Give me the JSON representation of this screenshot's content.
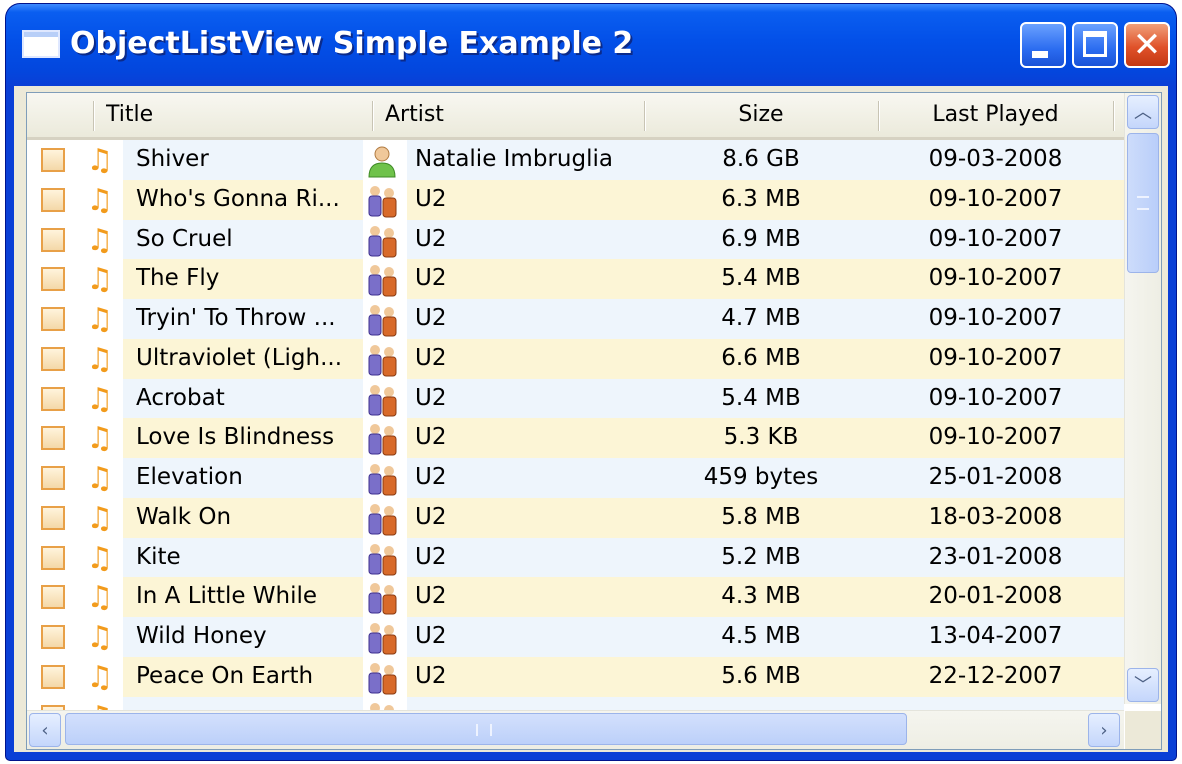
{
  "window": {
    "title": "ObjectListView Simple Example 2",
    "icons": [
      "window-icon",
      "minimize-icon",
      "maximize-icon",
      "close-icon"
    ],
    "accent": "#0a3fd6"
  },
  "listview": {
    "columns": [
      "Title",
      "Artist",
      "Size",
      "Last Played"
    ],
    "row_colors": {
      "even": "#eef5fc",
      "odd": "#fcf5d6"
    },
    "rows": [
      {
        "title": "Shiver",
        "artist": "Natalie Imbruglia",
        "artist_icon": "user-icon",
        "size": "8.6 GB",
        "last_played": "09-03-2008"
      },
      {
        "title": "Who's Gonna Ri...",
        "artist": "U2",
        "artist_icon": "group-icon",
        "size": "6.3 MB",
        "last_played": "09-10-2007"
      },
      {
        "title": "So Cruel",
        "artist": "U2",
        "artist_icon": "group-icon",
        "size": "6.9 MB",
        "last_played": "09-10-2007"
      },
      {
        "title": "The Fly",
        "artist": "U2",
        "artist_icon": "group-icon",
        "size": "5.4 MB",
        "last_played": "09-10-2007"
      },
      {
        "title": "Tryin' To Throw ...",
        "artist": "U2",
        "artist_icon": "group-icon",
        "size": "4.7 MB",
        "last_played": "09-10-2007"
      },
      {
        "title": "Ultraviolet (Ligh...",
        "artist": "U2",
        "artist_icon": "group-icon",
        "size": "6.6 MB",
        "last_played": "09-10-2007"
      },
      {
        "title": "Acrobat",
        "artist": "U2",
        "artist_icon": "group-icon",
        "size": "5.4 MB",
        "last_played": "09-10-2007"
      },
      {
        "title": "Love Is Blindness",
        "artist": "U2",
        "artist_icon": "group-icon",
        "size": "5.3 KB",
        "last_played": "09-10-2007"
      },
      {
        "title": "Elevation",
        "artist": "U2",
        "artist_icon": "group-icon",
        "size": "459 bytes",
        "last_played": "25-01-2008"
      },
      {
        "title": "Walk On",
        "artist": "U2",
        "artist_icon": "group-icon",
        "size": "5.8 MB",
        "last_played": "18-03-2008"
      },
      {
        "title": "Kite",
        "artist": "U2",
        "artist_icon": "group-icon",
        "size": "5.2 MB",
        "last_played": "23-01-2008"
      },
      {
        "title": "In A Little While",
        "artist": "U2",
        "artist_icon": "group-icon",
        "size": "4.3 MB",
        "last_played": "20-01-2008"
      },
      {
        "title": "Wild Honey",
        "artist": "U2",
        "artist_icon": "group-icon",
        "size": "4.5 MB",
        "last_played": "13-04-2007"
      },
      {
        "title": "Peace On Earth",
        "artist": "U2",
        "artist_icon": "group-icon",
        "size": "5.6 MB",
        "last_played": "22-12-2007"
      },
      {
        "title": "",
        "artist": "",
        "artist_icon": "group-icon",
        "size": "",
        "last_played": ""
      }
    ]
  },
  "scrollbars": {
    "vertical": {
      "icons": [
        "scroll-up-icon",
        "scroll-down-icon"
      ]
    },
    "horizontal": {
      "icons": [
        "scroll-left-icon",
        "scroll-right-icon"
      ]
    }
  }
}
